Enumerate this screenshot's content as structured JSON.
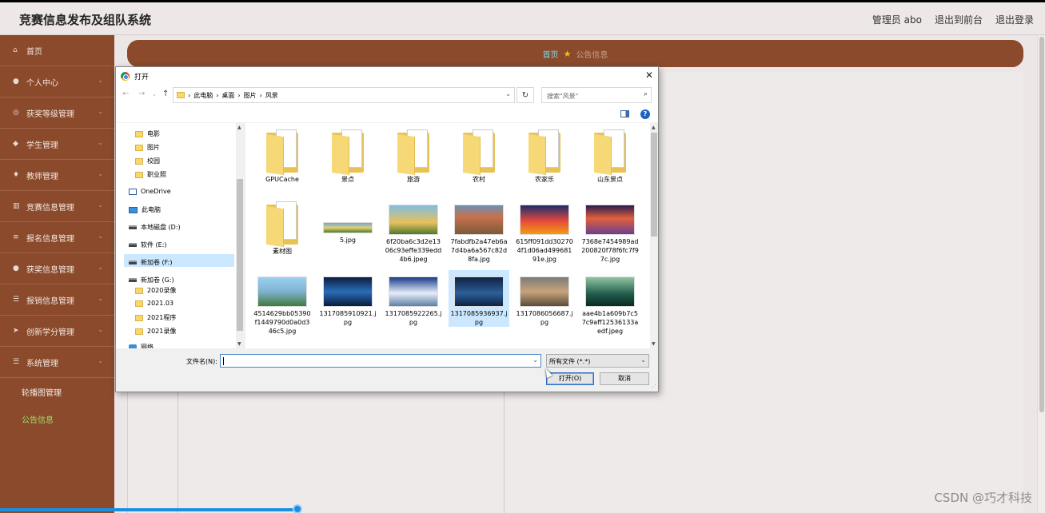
{
  "header": {
    "app_title": "竞赛信息发布及组队系统",
    "admin_label": "管理员 abo",
    "to_frontend": "退出到前台",
    "logout": "退出登录"
  },
  "sidebar": {
    "items": [
      {
        "label": "首页",
        "icon": "home-icon"
      },
      {
        "label": "个人中心",
        "icon": "user-icon"
      },
      {
        "label": "获奖等级管理",
        "icon": "award-icon"
      },
      {
        "label": "学生管理",
        "icon": "student-icon"
      },
      {
        "label": "教师管理",
        "icon": "teacher-icon"
      },
      {
        "label": "竞赛信息管理",
        "icon": "chart-icon"
      },
      {
        "label": "报名信息管理",
        "icon": "form-icon"
      },
      {
        "label": "获奖信息管理",
        "icon": "person-icon"
      },
      {
        "label": "报销信息管理",
        "icon": "list-icon"
      },
      {
        "label": "创新学分管理",
        "icon": "send-icon"
      },
      {
        "label": "系统管理",
        "icon": "menu-icon"
      }
    ],
    "sub_items": [
      {
        "label": "轮播图管理",
        "active": false
      },
      {
        "label": "公告信息",
        "active": true
      }
    ]
  },
  "breadcrumb": {
    "home": "首页",
    "current": "公告信息"
  },
  "dialog": {
    "title": "打开",
    "address": [
      "此电脑",
      "桌面",
      "图片",
      "风景"
    ],
    "search_placeholder": "搜索\"风景\"",
    "tree": [
      {
        "label": "电影",
        "kind": "folder"
      },
      {
        "label": "图片",
        "kind": "folder"
      },
      {
        "label": "校园",
        "kind": "folder"
      },
      {
        "label": "职业照",
        "kind": "folder"
      },
      {
        "label": "OneDrive",
        "kind": "onedrive"
      },
      {
        "label": "此电脑",
        "kind": "pc"
      },
      {
        "label": "本地磁盘 (D:)",
        "kind": "drive"
      },
      {
        "label": "软件 (E:)",
        "kind": "drive"
      },
      {
        "label": "新加卷 (F:)",
        "kind": "drive"
      },
      {
        "label": "新加卷 (G:)",
        "kind": "drive"
      },
      {
        "label": "2020录像",
        "kind": "folder"
      },
      {
        "label": "2021.03",
        "kind": "folder"
      },
      {
        "label": "2021程序",
        "kind": "folder"
      },
      {
        "label": "2021录像",
        "kind": "folder"
      },
      {
        "label": "网络",
        "kind": "network"
      }
    ],
    "files": [
      {
        "name": "GPUCache",
        "kind": "folder"
      },
      {
        "name": "景点",
        "kind": "folder"
      },
      {
        "name": "旅游",
        "kind": "folder"
      },
      {
        "name": "农村",
        "kind": "folder"
      },
      {
        "name": "农家乐",
        "kind": "folder"
      },
      {
        "name": "山东景点",
        "kind": "folder"
      },
      {
        "name": "素材图",
        "kind": "folder"
      },
      {
        "name": "5.jpg",
        "kind": "image"
      },
      {
        "name": "6f20ba6c3d2e1306c93effe339edd4b6.jpeg",
        "kind": "image"
      },
      {
        "name": "7fabdfb2a47eb6a7d4ba6a567c82d8fa.jpg",
        "kind": "image"
      },
      {
        "name": "615ff091dd302704f1d06ad49968191e.jpg",
        "kind": "image"
      },
      {
        "name": "7368e7454989ad200820f78f6fc7f97c.jpg",
        "kind": "image"
      },
      {
        "name": "4514629bb05390f1449790d0a0d346c5.jpg",
        "kind": "image"
      },
      {
        "name": "1317085910921.jpg",
        "kind": "image"
      },
      {
        "name": "1317085922265.jpg",
        "kind": "image"
      },
      {
        "name": "1317085936937.jpg",
        "kind": "image",
        "selected": true
      },
      {
        "name": "1317086056687.jpg",
        "kind": "image"
      },
      {
        "name": "aae4b1a609b7c57c9aff12536133aedf.jpeg",
        "kind": "image"
      }
    ],
    "filename_label": "文件名(N):",
    "filename_value": "",
    "filetype_value": "所有文件 (*.*)",
    "open_button": "打开(O)",
    "cancel_button": "取消"
  },
  "watermark": "CSDN @巧才科技",
  "colors": {
    "sidebar_bg": "#8a4a2b",
    "breadcrumb_bg": "#8a4a2b",
    "active_sub": "#9be06a",
    "crumb_home": "#7ed8e8"
  }
}
